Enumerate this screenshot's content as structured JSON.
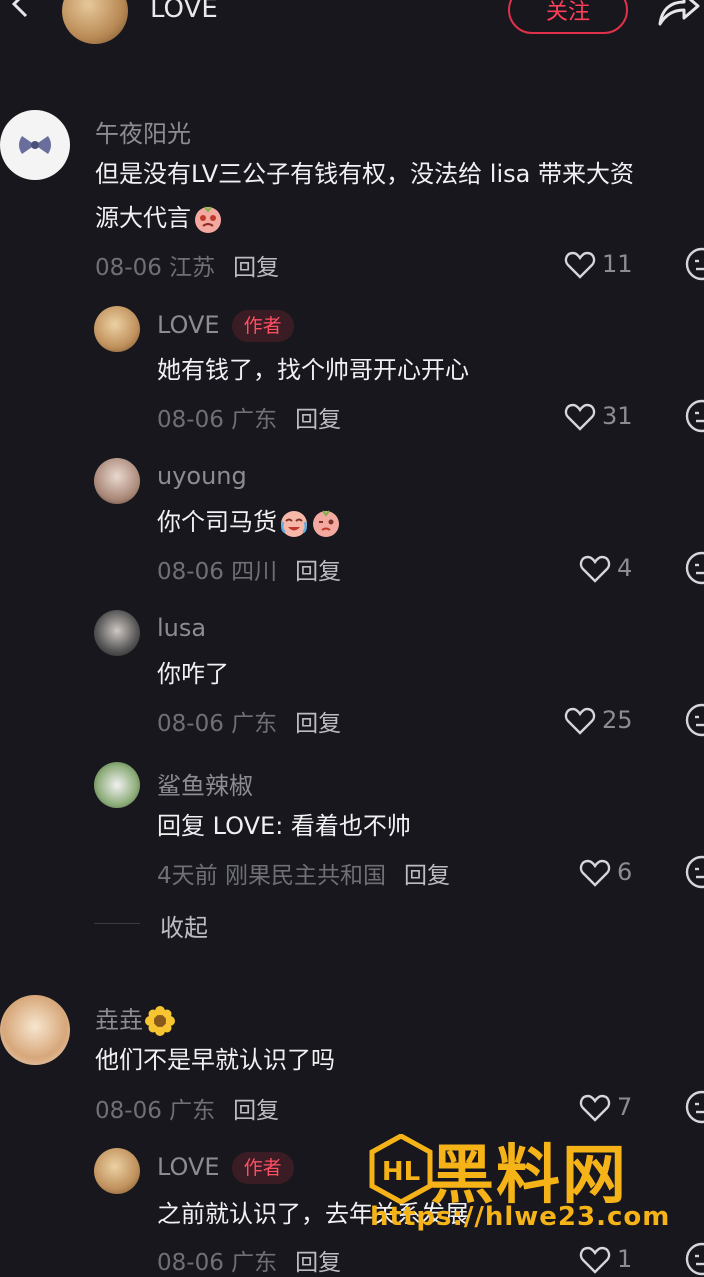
{
  "header": {
    "title": "LOVE",
    "follow_label": "关注"
  },
  "comments": [
    {
      "name": "午夜阳光",
      "text_lines": [
        "但是没有LV三公子有钱有权，没法给 lisa 带来大资",
        "源大代言"
      ],
      "date": "08-06",
      "location": "江苏",
      "reply_label": "回复",
      "likes": "11",
      "replies": [
        {
          "name": "LOVE",
          "badge": "作者",
          "text": "她有钱了，找个帅哥开心开心",
          "date": "08-06",
          "location": "广东",
          "reply_label": "回复",
          "likes": "31"
        },
        {
          "name": "uyoung",
          "text": "你个司马货",
          "date": "08-06",
          "location": "四川",
          "reply_label": "回复",
          "likes": "4"
        },
        {
          "name": "lusa",
          "text": "你咋了",
          "date": "08-06",
          "location": "广东",
          "reply_label": "回复",
          "likes": "25"
        },
        {
          "name": "鲨鱼辣椒",
          "text": "回复 LOVE: 看着也不帅",
          "date": "4天前",
          "location": "刚果民主共和国",
          "reply_label": "回复",
          "likes": "6"
        }
      ],
      "collapse_label": "收起"
    },
    {
      "name": "垚垚",
      "text": "他们不是早就认识了吗",
      "date": "08-06",
      "location": "广东",
      "reply_label": "回复",
      "likes": "7",
      "replies": [
        {
          "name": "LOVE",
          "badge": "作者",
          "text": "之前就认识了，去年关系发展",
          "date": "08-06",
          "location": "广东",
          "reply_label": "回复",
          "likes": "1"
        }
      ]
    }
  ],
  "watermark": {
    "title": "黑料网",
    "url": "https://hlwe23.com"
  },
  "colors": {
    "background": "#17171d",
    "accent": "#ff3f58",
    "watermark": "#f6b318"
  }
}
